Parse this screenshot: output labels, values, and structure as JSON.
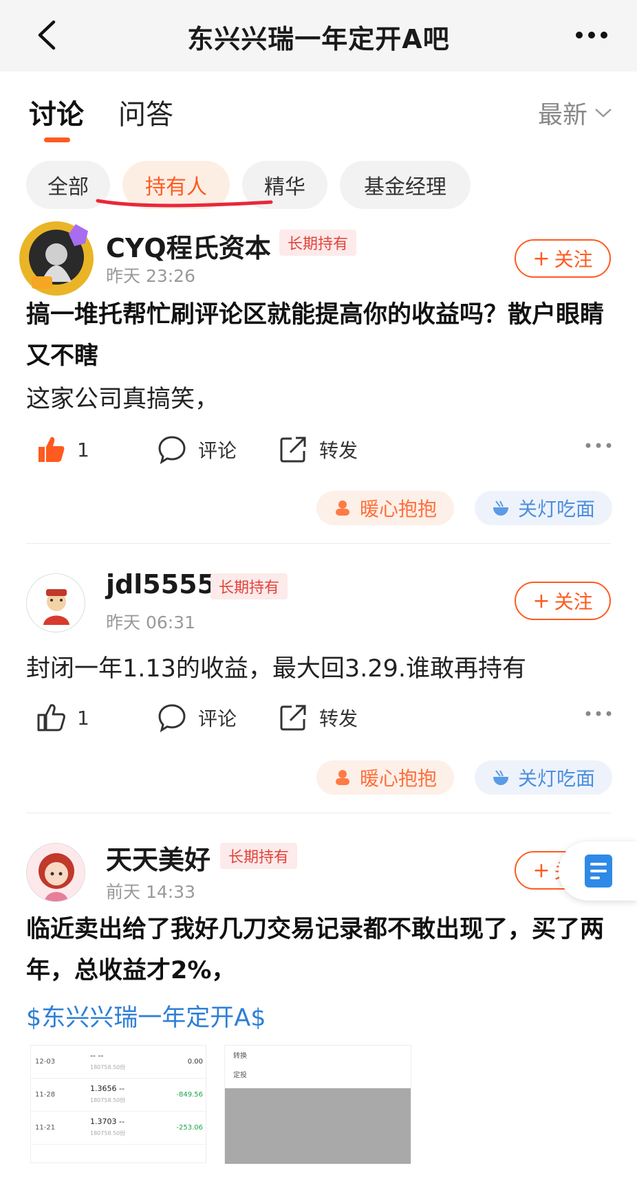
{
  "nav": {
    "title": "东兴兴瑞一年定开A吧"
  },
  "tabs": {
    "discuss": "讨论",
    "qa": "问答",
    "sort": "最新"
  },
  "chips": [
    "全部",
    "持有人",
    "精华",
    "基金经理"
  ],
  "colors": {
    "accent": "#ff5a1f",
    "link": "#2e7fd6",
    "badge_text": "#e0443a"
  },
  "posts": [
    {
      "username": "CYQ程氏资本",
      "badge": "长期持有",
      "time": "昨天 23:26",
      "follow": "关注",
      "title": "搞一堆托帮忙刷评论区就能提高你的收益吗？散户眼睛又不瞎",
      "body": "这家公司真搞笑，",
      "likes": "1",
      "liked": true,
      "comment": "评论",
      "share": "转发",
      "react_warm": "暖心抱抱",
      "react_lamp": "关灯吃面"
    },
    {
      "username": "jdl5555",
      "badge": "长期持有",
      "time": "昨天 06:31",
      "follow": "关注",
      "body": "封闭一年1.13的收益，最大回3.29.谁敢再持有",
      "likes": "1",
      "liked": false,
      "comment": "评论",
      "share": "转发",
      "react_warm": "暖心抱抱",
      "react_lamp": "关灯吃面"
    },
    {
      "username": "天天美好",
      "badge": "长期持有",
      "time": "前天 14:33",
      "follow": "关注",
      "title": "临近卖出给了我好几刀交易记录都不敢出现了，买了两年，总收益才2%，",
      "fund_link": "$东兴兴瑞一年定开A$"
    }
  ],
  "thumb_table": [
    {
      "date": "12-03",
      "nav": "-- --",
      "shares": "180758.50份",
      "amount": "0.00",
      "neg": false
    },
    {
      "date": "11-28",
      "nav": "1.3656 --",
      "shares": "180758.50份",
      "amount": "-849.56",
      "neg": true
    },
    {
      "date": "11-21",
      "nav": "1.3703 --",
      "shares": "180758.50份",
      "amount": "-253.06",
      "neg": true
    }
  ],
  "thumb_menu": [
    "转换",
    "定投"
  ]
}
